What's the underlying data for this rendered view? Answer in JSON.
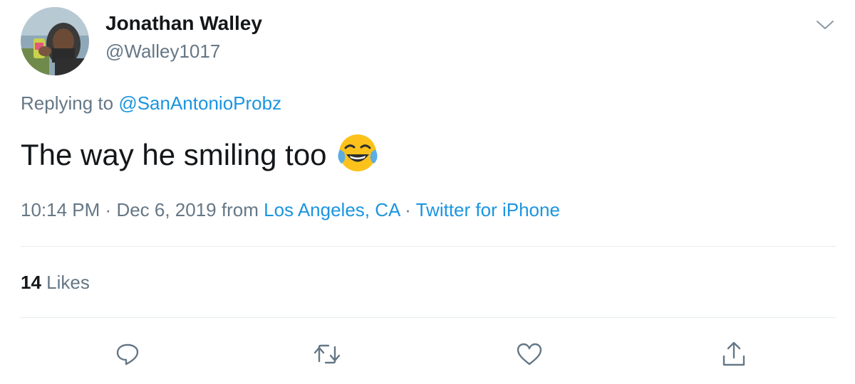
{
  "author": {
    "display_name": "Jonathan Walley",
    "handle": "@Walley1017",
    "avatar_icon": "user-avatar-photo"
  },
  "reply": {
    "prefix": "Replying to",
    "mention": "@SanAntonioProbz"
  },
  "tweet": {
    "text": "The way he smiling too",
    "emoji_icon": "face-with-tears-of-joy-emoji"
  },
  "meta": {
    "time": "10:14 PM",
    "separator": "·",
    "date": "Dec 6, 2019",
    "from_label": "from",
    "location": "Los Angeles, CA",
    "source": "Twitter for iPhone"
  },
  "stats": {
    "likes_count": "14",
    "likes_label": "Likes"
  },
  "actions": {
    "reply_icon": "reply-icon",
    "retweet_icon": "retweet-icon",
    "like_icon": "heart-icon",
    "share_icon": "share-icon",
    "menu_icon": "chevron-down-icon"
  },
  "colors": {
    "text": "#14171a",
    "secondary": "#657786",
    "link": "#1b95e0",
    "divider": "#e6ecf0"
  }
}
